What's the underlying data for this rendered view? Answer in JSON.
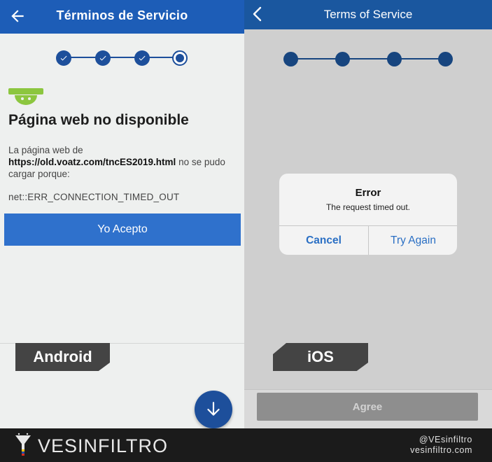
{
  "android": {
    "header": {
      "title": "Términos de Servicio"
    },
    "error": {
      "heading": "Página web no disponible",
      "body_prefix": "La página web de",
      "url": "https://old.voatz.com/tncES2019.html",
      "body_suffix": "no se pudo cargar porque:",
      "code": "net::ERR_CONNECTION_TIMED_OUT"
    },
    "accept_label": "Yo Acepto",
    "colors": {
      "header": "#1d5db7",
      "button": "#2f71cc",
      "fab": "#1d4f9b"
    }
  },
  "ios": {
    "header": {
      "title": "Terms of Service"
    },
    "alert": {
      "title": "Error",
      "message": "The request timed out.",
      "cancel_label": "Cancel",
      "retry_label": "Try Again"
    },
    "agree_label": "Agree",
    "colors": {
      "header": "#1a579f",
      "alert_button": "#2a6fc4"
    }
  },
  "labels": {
    "android": "Android",
    "ios": "iOS"
  },
  "brand": {
    "name": "VESINFILTRO",
    "handle": "@VEsinfiltro",
    "site": "vesinfiltro.com"
  }
}
